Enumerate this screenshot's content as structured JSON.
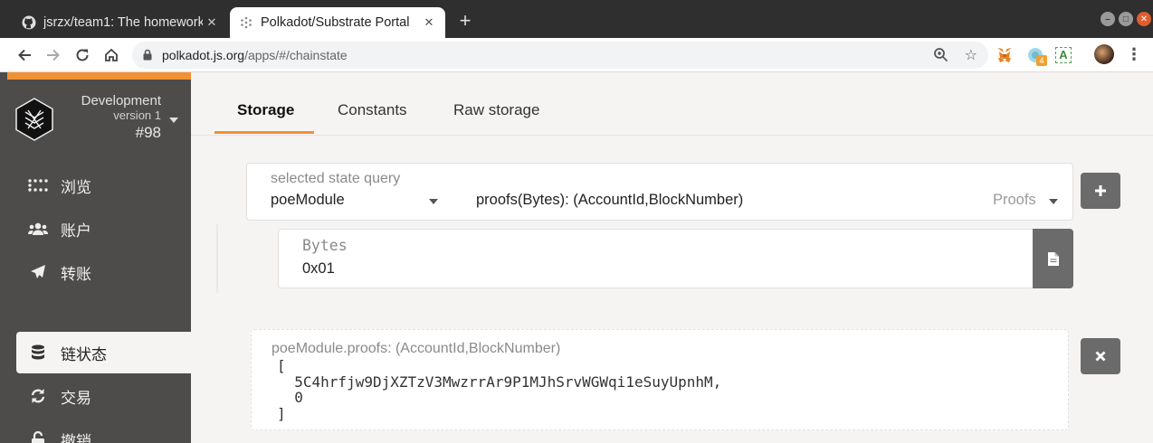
{
  "browser": {
    "tabs": [
      {
        "title": "jsrzx/team1: The homework",
        "favicon": "github-icon",
        "active": false
      },
      {
        "title": "Polkadot/Substrate Portal",
        "favicon": "polkadot-icon",
        "active": true
      }
    ],
    "url_host": "polkadot.js.org",
    "url_path": "/apps/#/chainstate",
    "extension_badge": "4",
    "extension_letter": "A"
  },
  "sidebar": {
    "chain_name": "Development",
    "version": "version 1",
    "block": "#98",
    "items": [
      {
        "label": "浏览",
        "icon": "grid-icon"
      },
      {
        "label": "账户",
        "icon": "users-icon"
      },
      {
        "label": "转账",
        "icon": "paper-plane-icon"
      },
      {
        "label": "链状态",
        "icon": "database-icon",
        "active": true
      },
      {
        "label": "交易",
        "icon": "sync-icon"
      },
      {
        "label": "撤销",
        "icon": "unlock-icon"
      }
    ],
    "accent_color": "#f19135"
  },
  "main": {
    "tabs": [
      {
        "label": "Storage",
        "selected": true
      },
      {
        "label": "Constants",
        "selected": false
      },
      {
        "label": "Raw storage",
        "selected": false
      }
    ],
    "query": {
      "label": "selected state query",
      "module": "poeModule",
      "method": "proofs(Bytes): (AccountId,BlockNumber)",
      "doc": "Proofs"
    },
    "param": {
      "label": "Bytes",
      "value": "0x01"
    },
    "result": {
      "label": "poeModule.proofs: (AccountId,BlockNumber)",
      "value": "[\n  5C4hrfjw9DjXZTzV3MwzrrAr9P1MJhSrvWGWqi1eSuyUpnhM,\n  0\n]"
    }
  }
}
